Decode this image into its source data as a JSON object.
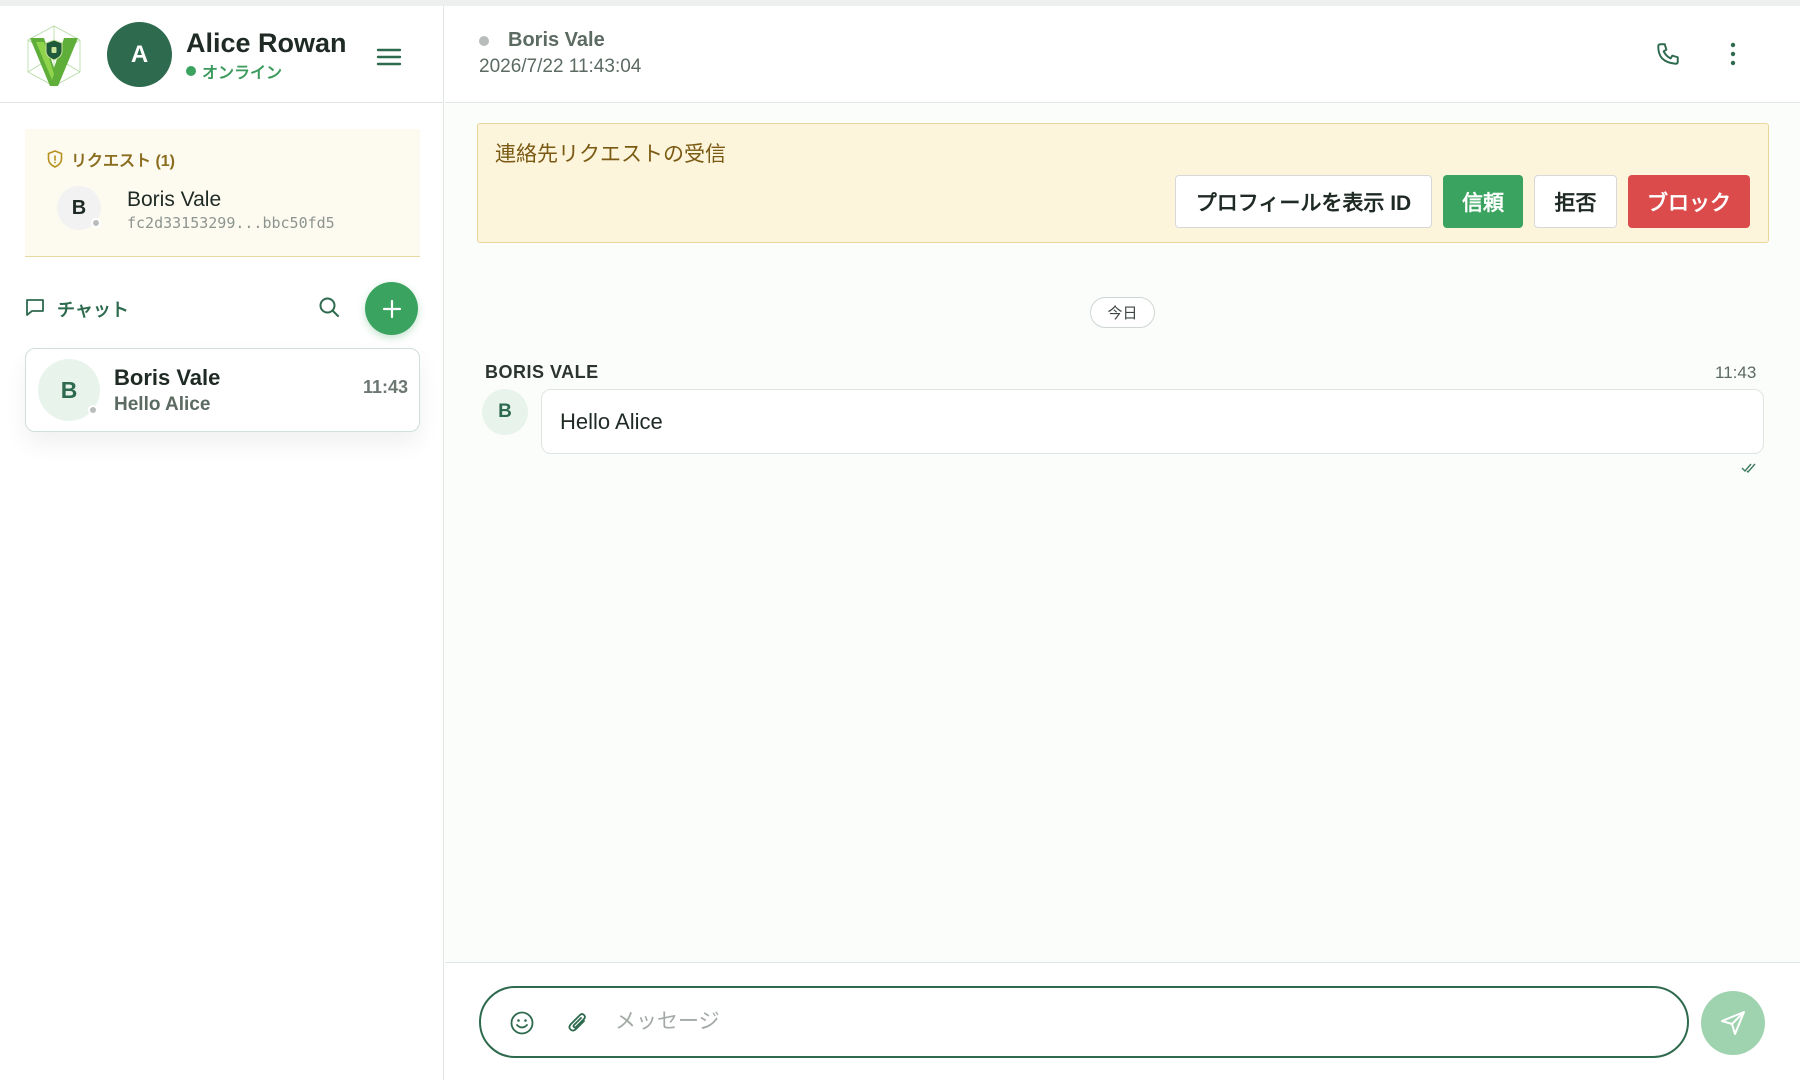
{
  "colors": {
    "brand_green": "#2e6a4e",
    "accent_green": "#3aa35f",
    "danger_red": "#dc4b4b",
    "banner_bg": "#fdf4dc"
  },
  "user": {
    "avatar_initial": "A",
    "name": "Alice Rowan",
    "status": "オンライン"
  },
  "requests": {
    "title": "リクエスト (1)",
    "items": [
      {
        "avatar_initial": "B",
        "name": "Boris Vale",
        "id": "fc2d33153299...bbc50fd5"
      }
    ]
  },
  "chats": {
    "label": "チャット",
    "items": [
      {
        "avatar_initial": "B",
        "name": "Boris Vale",
        "preview": "Hello Alice",
        "time": "11:43"
      }
    ]
  },
  "conversation": {
    "peer_name": "Boris Vale",
    "timestamp": "2026/7/22 11:43:04",
    "banner": {
      "title": "連絡先リクエストの受信",
      "profile_label": "プロフィールを表示 ID",
      "trust_label": "信頼",
      "reject_label": "拒否",
      "block_label": "ブロック"
    },
    "day_separator": "今日",
    "messages": [
      {
        "sender": "BORIS VALE",
        "time": "11:43",
        "avatar_initial": "B",
        "text": "Hello Alice"
      }
    ]
  },
  "composer": {
    "placeholder": "メッセージ",
    "value": ""
  },
  "icons": {
    "menu": "hamburger-icon",
    "shield": "shield-icon",
    "chat": "chat-bubble-icon",
    "search": "search-icon",
    "add": "plus-icon",
    "phone": "phone-icon",
    "more": "kebab-icon",
    "emoji": "smiley-icon",
    "attach": "paperclip-icon",
    "send": "send-icon",
    "read": "double-check-icon"
  }
}
